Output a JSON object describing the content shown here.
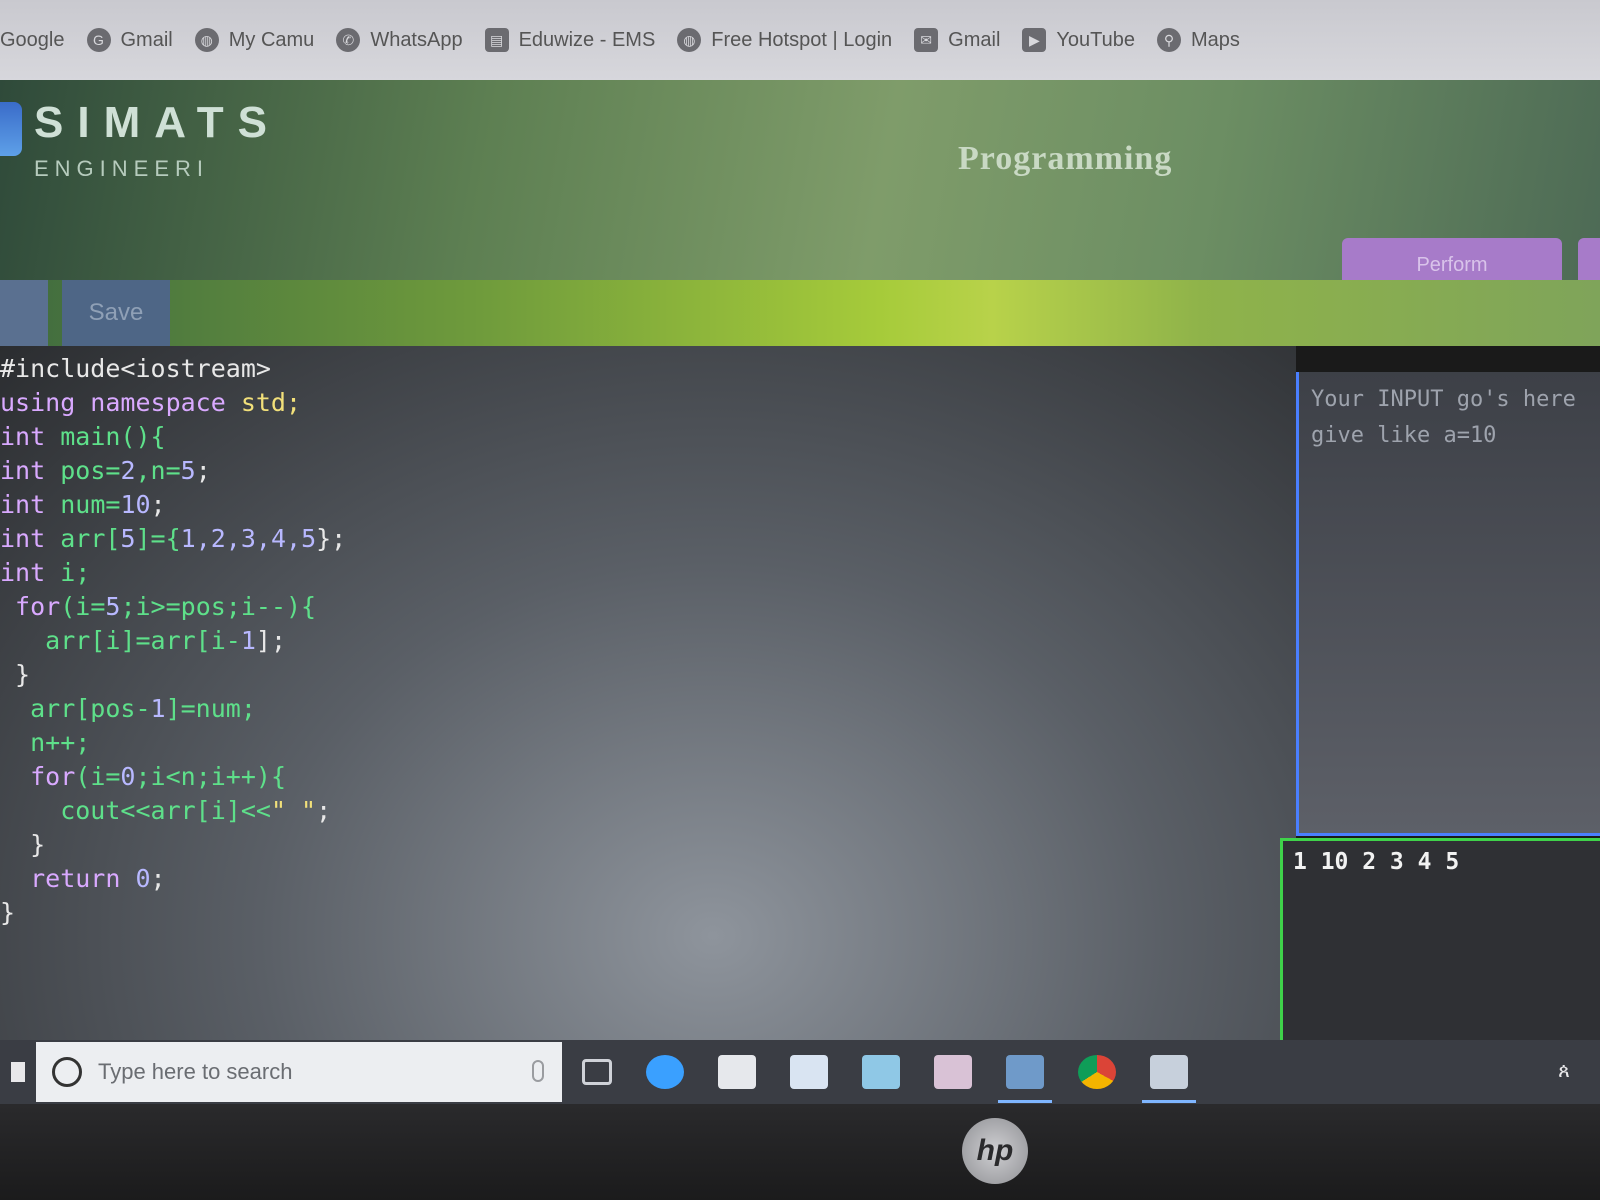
{
  "bookmarks": [
    {
      "label": "Google",
      "icon": "google-icon"
    },
    {
      "label": "Gmail",
      "icon": "gmail-icon"
    },
    {
      "label": "My Camu",
      "icon": "globe-icon"
    },
    {
      "label": "WhatsApp",
      "icon": "whatsapp-icon"
    },
    {
      "label": "Eduwize - EMS",
      "icon": "page-icon"
    },
    {
      "label": "Free Hotspot | Login",
      "icon": "globe-icon"
    },
    {
      "label": "Gmail",
      "icon": "mail-icon"
    },
    {
      "label": "YouTube",
      "icon": "youtube-icon"
    },
    {
      "label": "Maps",
      "icon": "maps-icon"
    }
  ],
  "header": {
    "brand": "SIMATS",
    "brand_sub": "ENGINEERI",
    "page_title": "Programming",
    "run_button": "Perform"
  },
  "toolbar": {
    "save_label": "Save"
  },
  "code": [
    [
      {
        "t": "#include<iostream>",
        "c": "plain"
      }
    ],
    [
      {
        "t": "using namespace ",
        "c": "kw"
      },
      {
        "t": "std;",
        "c": "str"
      }
    ],
    [
      {
        "t": "int ",
        "c": "kw"
      },
      {
        "t": "main(){",
        "c": "id"
      }
    ],
    [
      {
        "t": "int ",
        "c": "kw"
      },
      {
        "t": "pos=",
        "c": "id"
      },
      {
        "t": "2",
        "c": "num"
      },
      {
        "t": ",n=",
        "c": "id"
      },
      {
        "t": "5",
        "c": "num"
      },
      {
        "t": ";",
        "c": "plain"
      }
    ],
    [
      {
        "t": "int ",
        "c": "kw"
      },
      {
        "t": "num=",
        "c": "id"
      },
      {
        "t": "10",
        "c": "num"
      },
      {
        "t": ";",
        "c": "plain"
      }
    ],
    [
      {
        "t": "int ",
        "c": "kw"
      },
      {
        "t": "arr[",
        "c": "id"
      },
      {
        "t": "5",
        "c": "num"
      },
      {
        "t": "]={",
        "c": "id"
      },
      {
        "t": "1,2,3,4,5",
        "c": "num"
      },
      {
        "t": "};",
        "c": "plain"
      }
    ],
    [
      {
        "t": "int ",
        "c": "kw"
      },
      {
        "t": "i;",
        "c": "id"
      }
    ],
    [
      {
        "t": " for",
        "c": "kw"
      },
      {
        "t": "(i=",
        "c": "id"
      },
      {
        "t": "5",
        "c": "num"
      },
      {
        "t": ";i>=pos;i--){",
        "c": "id"
      }
    ],
    [
      {
        "t": "   arr[i]=arr[i-",
        "c": "id"
      },
      {
        "t": "1",
        "c": "num"
      },
      {
        "t": "];",
        "c": "plain"
      }
    ],
    [
      {
        "t": " }",
        "c": "plain"
      }
    ],
    [
      {
        "t": "  arr[pos-",
        "c": "id"
      },
      {
        "t": "1",
        "c": "num"
      },
      {
        "t": "]=num;",
        "c": "id"
      }
    ],
    [
      {
        "t": "  n++;",
        "c": "id"
      }
    ],
    [
      {
        "t": "  for",
        "c": "kw"
      },
      {
        "t": "(i=",
        "c": "id"
      },
      {
        "t": "0",
        "c": "num"
      },
      {
        "t": ";i<n;i++){",
        "c": "id"
      }
    ],
    [
      {
        "t": "    cout<<arr[i]<<",
        "c": "id"
      },
      {
        "t": "\" \"",
        "c": "str"
      },
      {
        "t": ";",
        "c": "plain"
      }
    ],
    [
      {
        "t": "  }",
        "c": "plain"
      }
    ],
    [
      {
        "t": "  return ",
        "c": "kw"
      },
      {
        "t": "0",
        "c": "num"
      },
      {
        "t": ";",
        "c": "plain"
      }
    ],
    [
      {
        "t": "}",
        "c": "plain"
      }
    ]
  ],
  "input_pane": {
    "line1": "Your INPUT go's here",
    "line2": "give like a=10"
  },
  "output_pane": {
    "text": "1 10 2 3 4 5"
  },
  "taskbar": {
    "search_placeholder": "Type here to search",
    "icons": [
      "task-view-icon",
      "edge-icon",
      "store-icon",
      "file-explorer-icon",
      "mail-icon",
      "media-icon",
      "photos-icon",
      "chrome-icon",
      "app-icon"
    ]
  },
  "device": {
    "logo": "hp"
  }
}
